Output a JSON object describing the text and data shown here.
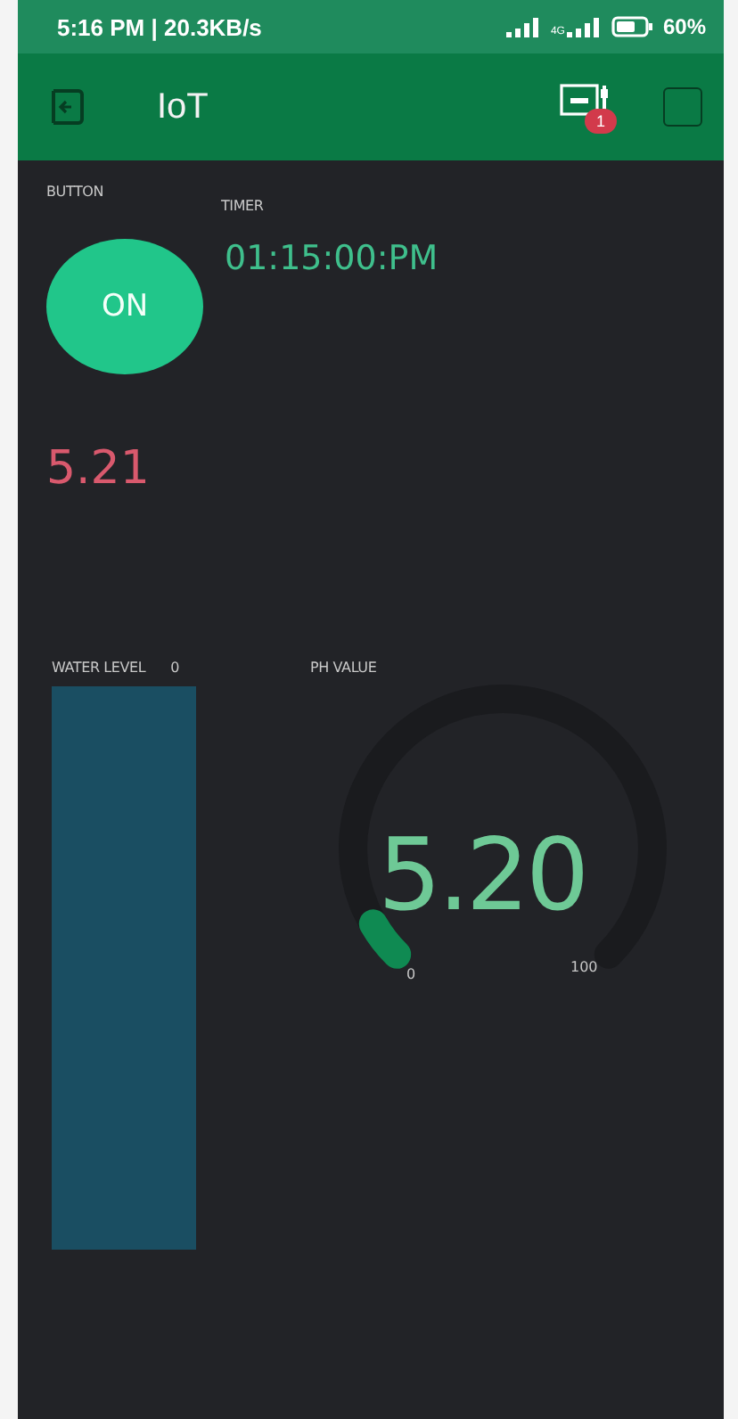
{
  "status_bar": {
    "time": "5:16 PM | 20.3KB/s",
    "network_type": "4G",
    "battery": "60%"
  },
  "app_bar": {
    "title": "IoT",
    "notification_count": "1"
  },
  "widgets": {
    "button": {
      "label": "BUTTON",
      "text": "ON",
      "on": true
    },
    "timer": {
      "label": "TIMER",
      "value": "01:15:00:PM"
    },
    "value_display": {
      "value": "5.21"
    },
    "water_level": {
      "label": "WATER LEVEL",
      "reading": "0",
      "level": 0
    },
    "ph_gauge": {
      "label": "PH VALUE",
      "value": "5.20",
      "min": "0",
      "max": "100"
    }
  }
}
